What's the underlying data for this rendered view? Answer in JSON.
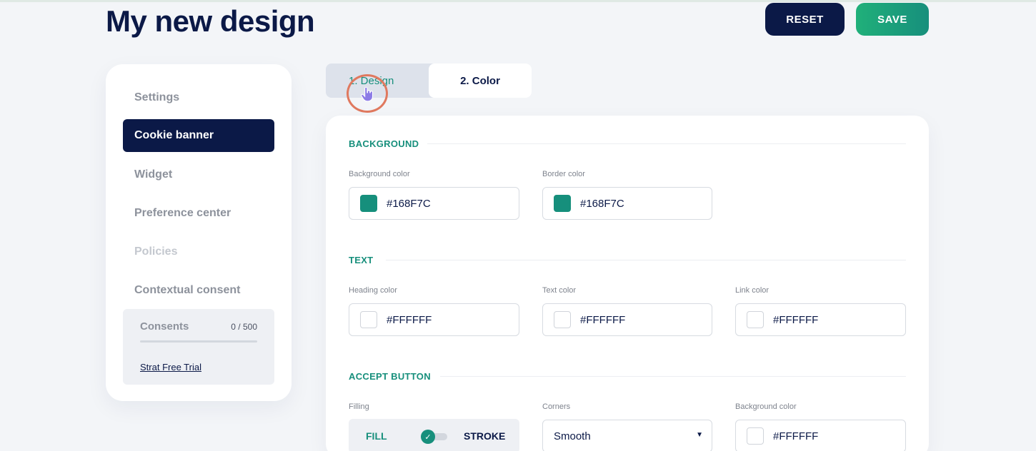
{
  "header": {
    "title": "My new design",
    "reset_label": "RESET",
    "save_label": "SAVE"
  },
  "sidebar": {
    "items": [
      {
        "label": "Settings",
        "state": "normal"
      },
      {
        "label": "Cookie banner",
        "state": "active"
      },
      {
        "label": "Widget",
        "state": "normal"
      },
      {
        "label": "Preference center",
        "state": "normal"
      },
      {
        "label": "Policies",
        "state": "disabled"
      },
      {
        "label": "Contextual consent",
        "state": "normal"
      }
    ],
    "consents": {
      "label": "Consents",
      "count": "0 / 500",
      "progress": 0,
      "trial_link": "Strat Free Trial"
    }
  },
  "tabs": {
    "design": "1. Design",
    "color": "2. Color",
    "active": "2. Color"
  },
  "panel": {
    "background": {
      "title": "BACKGROUND",
      "background_color": {
        "label": "Background color",
        "value": "#168F7C"
      },
      "border_color": {
        "label": "Border color",
        "value": "#168F7C"
      }
    },
    "text": {
      "title": "TEXT",
      "heading_color": {
        "label": "Heading color",
        "value": "#FFFFFF"
      },
      "text_color": {
        "label": "Text color",
        "value": "#FFFFFF"
      },
      "link_color": {
        "label": "Link color",
        "value": "#FFFFFF"
      }
    },
    "accept_button": {
      "title": "ACCEPT BUTTON",
      "filling": {
        "label": "Filling",
        "fill": "FILL",
        "stroke": "STROKE"
      },
      "corners": {
        "label": "Corners",
        "value": "Smooth"
      },
      "background_color": {
        "label": "Background color",
        "value": "#FFFFFF"
      }
    }
  },
  "colors": {
    "navy": "#0b1947",
    "green": "#178f7c",
    "swatch_green": "#168F7C",
    "swatch_white": "#FFFFFF"
  },
  "icons": {
    "cursor": "hand-pointer-icon",
    "check": "check-icon",
    "caret": "chevron-down-icon"
  }
}
